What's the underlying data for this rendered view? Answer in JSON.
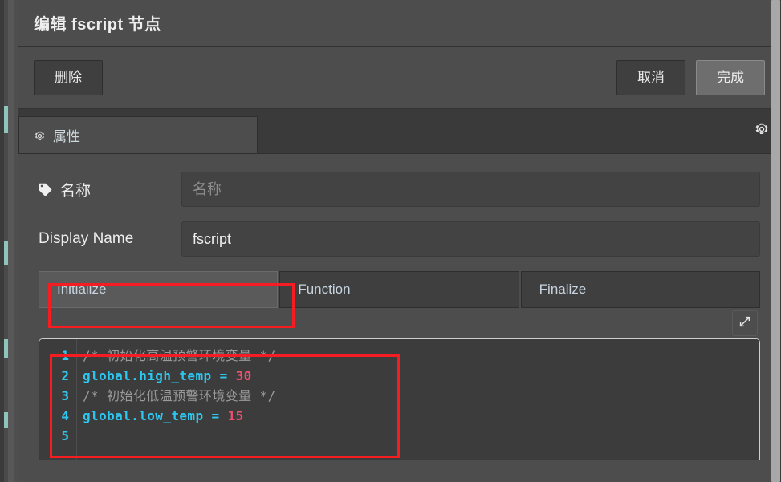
{
  "dialog": {
    "title": "编辑 fscript 节点"
  },
  "actionbar": {
    "delete_label": "删除",
    "cancel_label": "取消",
    "done_label": "完成"
  },
  "tabbar": {
    "properties_label": "属性",
    "properties_icon": "gear-icon",
    "settings_icon": "gear-icon"
  },
  "form": {
    "name": {
      "label": "名称",
      "icon": "tag-icon",
      "value": "",
      "placeholder": "名称"
    },
    "display_name": {
      "label": "Display Name",
      "value": "fscript",
      "placeholder": ""
    }
  },
  "code_tabs": [
    {
      "label": "Initialize",
      "active": true
    },
    {
      "label": "Function",
      "active": false
    },
    {
      "label": "Finalize",
      "active": false
    }
  ],
  "editor": {
    "expand_icon": "expand-arrows-icon",
    "line_numbers": [
      "1",
      "2",
      "3",
      "4",
      "5"
    ],
    "lines": [
      {
        "tokens": [
          {
            "t": "comment",
            "v": "/* 初始化高温预警环境变量 */"
          }
        ]
      },
      {
        "tokens": [
          {
            "t": "ident",
            "v": "global.high_temp"
          },
          {
            "t": "op",
            "v": " = "
          },
          {
            "t": "num",
            "v": "30"
          }
        ]
      },
      {
        "tokens": [
          {
            "t": "comment",
            "v": "/* 初始化低温预警环境变量 */"
          }
        ]
      },
      {
        "tokens": [
          {
            "t": "ident",
            "v": "global.low_temp"
          },
          {
            "t": "op",
            "v": " = "
          },
          {
            "t": "num",
            "v": "15"
          }
        ]
      },
      {
        "tokens": []
      }
    ]
  },
  "annotations": [
    {
      "name": "initialize-tab-highlight",
      "color": "#f51c22"
    },
    {
      "name": "code-editor-highlight",
      "color": "#f51c22"
    }
  ],
  "colors": {
    "panel_bg": "#4d4d4d",
    "tabbar_bg": "#3a3a3a",
    "field_bg": "#434343",
    "editor_bg": "#3c3c3c",
    "accent_red": "#f51c22",
    "code_cyan": "#2ec7f0",
    "code_pink": "#f0506e",
    "code_comment": "#9a9a9a"
  }
}
